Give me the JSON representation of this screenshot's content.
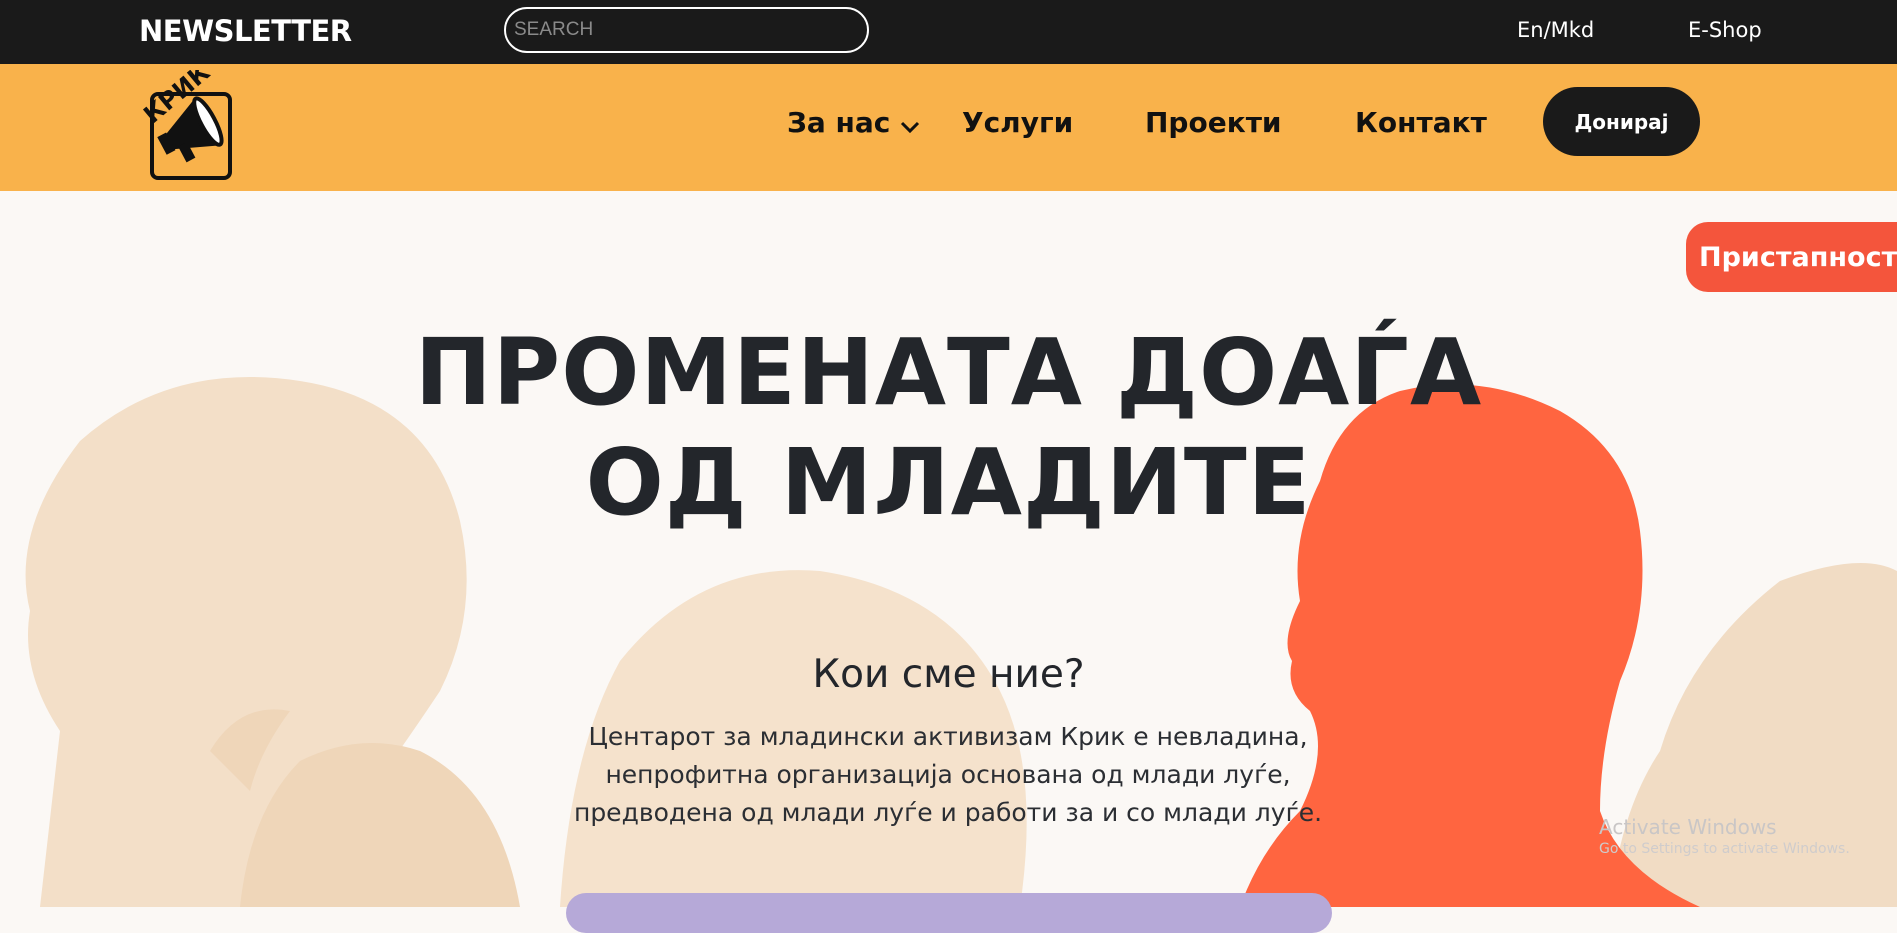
{
  "topbar": {
    "newsletter": "NEWSLETTER",
    "search_placeholder": "SEARCH",
    "language": "En/Mkd",
    "eshop": "E-Shop"
  },
  "logo": {
    "text": "КРИК"
  },
  "nav": {
    "items": [
      {
        "label": "За нас",
        "has_dropdown": true
      },
      {
        "label": "Услуги"
      },
      {
        "label": "Проекти"
      },
      {
        "label": "Контакт"
      }
    ],
    "donate": "Донирај"
  },
  "accessibility_label": "Пристапност",
  "hero": {
    "headline_line1": "ПРОМЕНАТА ДОАЃА",
    "headline_line2": "ОД МЛАДИТЕ",
    "subheading": "Кои сме ние?",
    "description_line1": "Центарот за младински активизам Крик е невладина,",
    "description_line2": "непрофитна организација основана од млади луѓе,",
    "description_line3": "предводена од млади луѓе и работи за и со млади луѓе."
  },
  "windows_watermark": {
    "title": "Activate Windows",
    "subtitle": "Go to Settings to activate Windows."
  },
  "colors": {
    "topbar": "#1a1a1a",
    "navbar": "#f9b24b",
    "accent_red": "#f4553c",
    "hero_bg": "#fbf8f5",
    "silhouette_light": "#f3dfc8",
    "silhouette_orange": "#ff6540",
    "purple_card": "#b6a9d8"
  }
}
